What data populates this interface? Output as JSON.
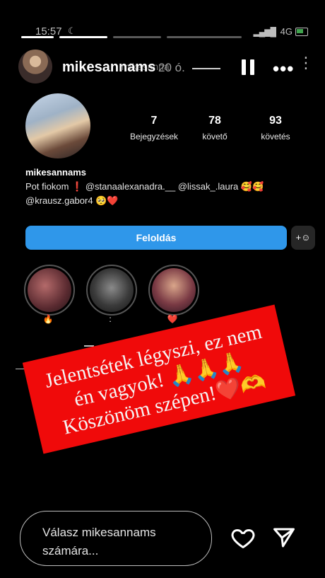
{
  "status_bar": {
    "time": "15:57",
    "moon_icon": "moon-icon",
    "network": "4G"
  },
  "story": {
    "username": "mikesannams",
    "ghost_username": "mikesanna",
    "age": "20 ó."
  },
  "profile": {
    "stats": [
      {
        "value": "7",
        "label": "Bejegyzések"
      },
      {
        "value": "78",
        "label": "követő"
      },
      {
        "value": "93",
        "label": "követés"
      }
    ],
    "name": "mikesannams",
    "bio_line1": "Pot fiokom ❗ @stanaalexanadra.__ @lissak_.laura 🥰🥰",
    "bio_line2": "@krausz.gabor4 🥺❤️",
    "unblock_label": "Feloldás",
    "add_user_glyph": "+☺"
  },
  "highlights": [
    {
      "label": "🔥"
    },
    {
      "label": ":"
    },
    {
      "label": "❤️"
    }
  ],
  "banner": {
    "line1": "Jelentsétek légyszi, ez nem",
    "line2": "én vagyok! 🙏🙏🙏",
    "line3": "Köszönöm szépen!❤️🫶",
    "color": "#f00a0a"
  },
  "reply": {
    "placeholder": "Válasz mikesannams számára..."
  },
  "accent": "#2f97ea"
}
